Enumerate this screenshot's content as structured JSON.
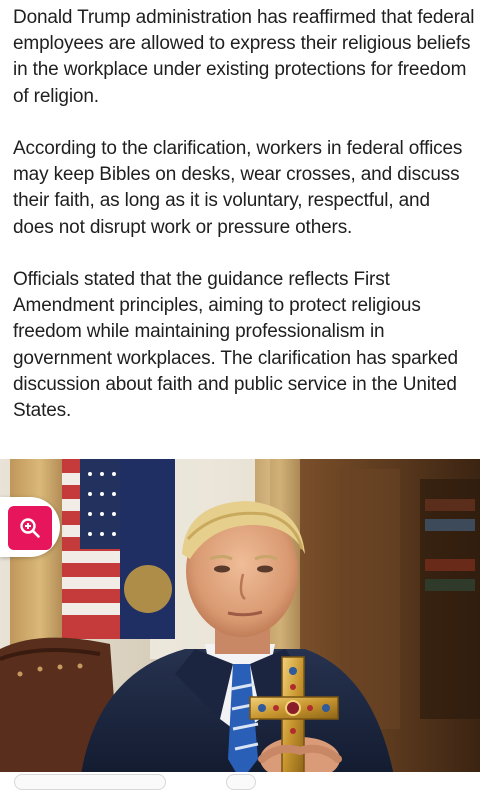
{
  "article": {
    "paragraphs": [
      "Donald Trump administration has reaffirmed that federal employees are allowed to express their religious beliefs in the workplace under existing protections for freedom of religion.",
      "According to the clarification, workers in federal offices may keep Bibles on desks, wear crosses, and discuss their faith, as long as it is voluntary, respectful, and does not disrupt work or pressure others.",
      "Officials stated that the guidance reflects First Amendment principles, aiming to protect religious freedom while maintaining professionalism in government workplaces. The clarification has sparked discussion about faith and public service in the United States."
    ]
  },
  "photo": {
    "subject": "man in suit holding ornate cross in office with flags"
  },
  "zoom": {
    "icon": "zoom-in-icon",
    "color": "#e7155c"
  }
}
